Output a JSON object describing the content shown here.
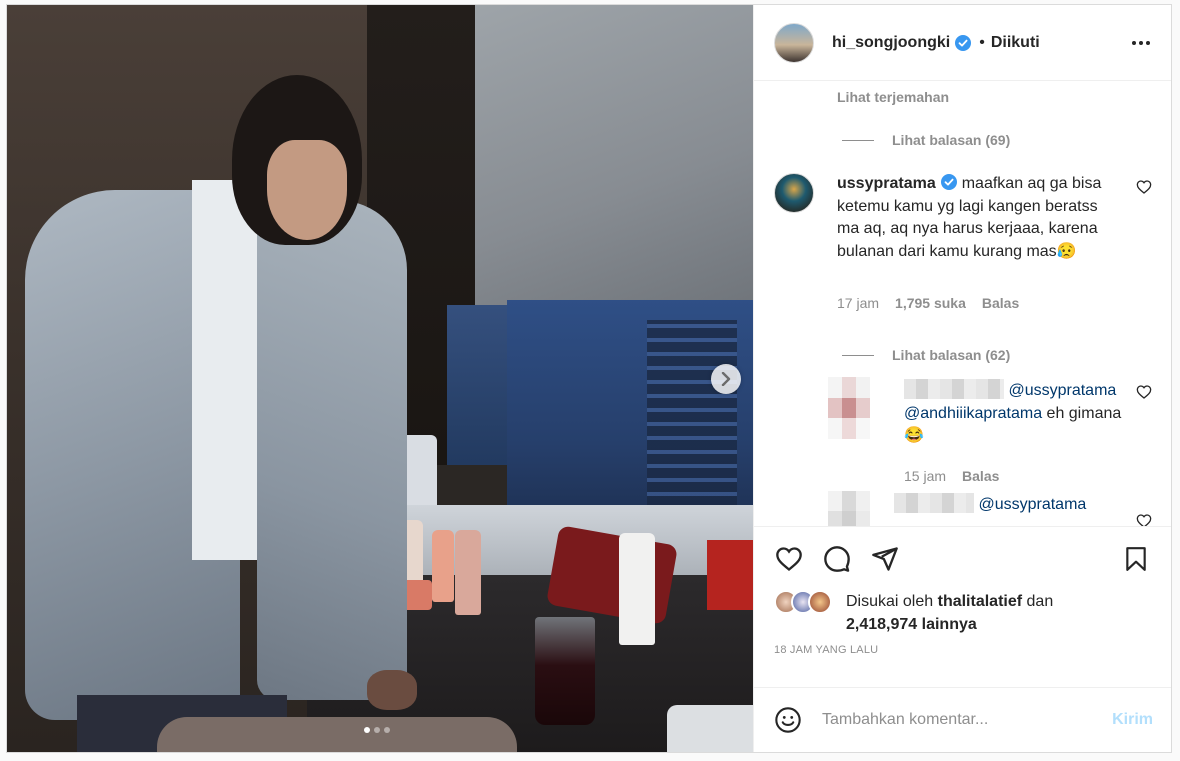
{
  "post": {
    "username": "hi_songjoongki",
    "separator": "•",
    "follow_status": "Diikuti",
    "more_icon": "more-horizontal-icon"
  },
  "media": {
    "slide_count": 3,
    "active_slide": 1,
    "next_icon": "chevron-right-icon"
  },
  "comments": {
    "translate_label": "Lihat terjemahan",
    "replies_1": "Lihat balasan (69)",
    "replies_2": "Lihat balasan (62)",
    "items": [
      {
        "author": "ussypratama",
        "text": "maafkan aq ga bisa ketemu kamu yg lagi kangen beratss ma aq, aq nya harus kerjaaa, karena bulanan dari kamu kurang mas😥",
        "time": "17 jam",
        "likes": "1,795 suka",
        "reply_label": "Balas"
      },
      {
        "mention_1": "@ussypratama",
        "mention_2": "@andhiiikapratama",
        "text": " eh gimana 😂",
        "time": "15 jam",
        "reply_label": "Balas"
      },
      {
        "mention_1": "@ussypratama"
      }
    ]
  },
  "actions": {
    "like_icon": "heart-icon",
    "comment_icon": "comment-icon",
    "share_icon": "send-icon",
    "save_icon": "bookmark-icon"
  },
  "likes": {
    "prefix": "Disukai oleh ",
    "user": "thalitalatief",
    "conjunction": " dan",
    "count": "2,418,974 lainnya"
  },
  "time_ago": "18 JAM YANG LALU",
  "add_comment": {
    "placeholder": "Tambahkan komentar...",
    "send_label": "Kirim",
    "emoji_icon": "smiley-icon"
  },
  "colors": {
    "verified": "#3897f0",
    "link": "#00376b",
    "muted": "#8e8e8e",
    "send_disabled": "#b2dffc"
  }
}
